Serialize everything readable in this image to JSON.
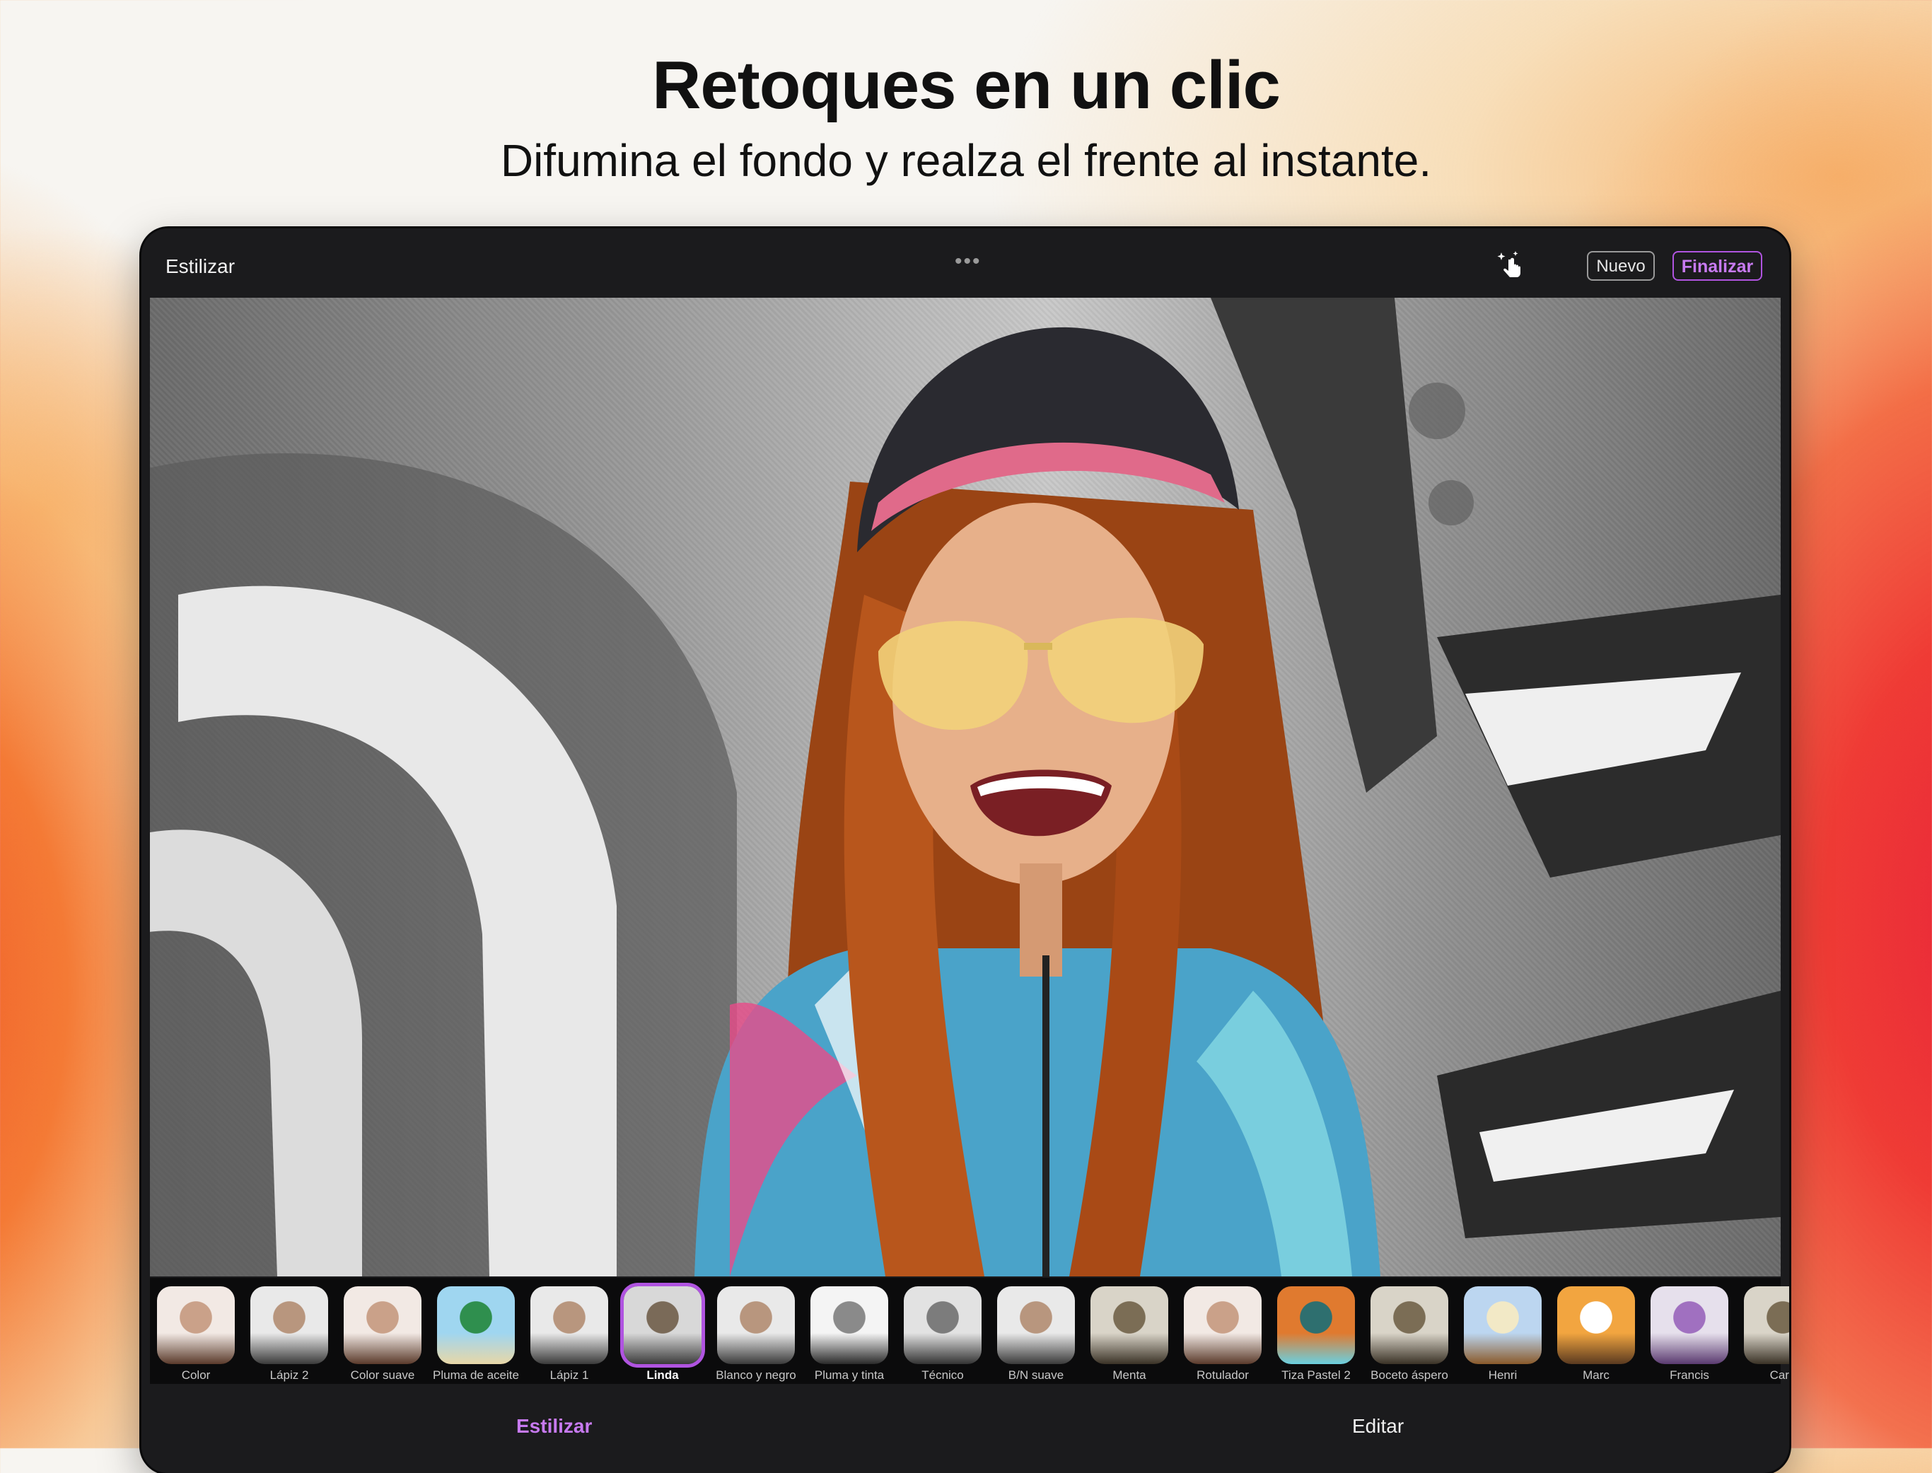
{
  "headline": "Retoques en un clic",
  "subheadline": "Difumina el fondo y realza el frente al instante.",
  "app": {
    "title": "Estilizar",
    "more_icon": "more-dots-icon",
    "magic_icon": "magic-tap-icon",
    "new_button": "Nuevo",
    "done_button": "Finalizar",
    "accent_color": "#b054e0"
  },
  "styles": [
    {
      "label": "Color",
      "icon": "portrait-woman"
    },
    {
      "label": "Lápiz 2",
      "icon": "portrait-man"
    },
    {
      "label": "Color suave",
      "icon": "portrait-woman"
    },
    {
      "label": "Pluma de aceite",
      "icon": "beach-palm"
    },
    {
      "label": "Lápiz 1",
      "icon": "portrait-man"
    },
    {
      "label": "Linda",
      "icon": "giraffe",
      "selected": true
    },
    {
      "label": "Blanco y negro",
      "icon": "portrait-man"
    },
    {
      "label": "Pluma y tinta",
      "icon": "skyscraper"
    },
    {
      "label": "Técnico",
      "icon": "house"
    },
    {
      "label": "B/N suave",
      "icon": "portrait-man"
    },
    {
      "label": "Menta",
      "icon": "building"
    },
    {
      "label": "Rotulador",
      "icon": "portrait-woman"
    },
    {
      "label": "Tiza Pastel 2",
      "icon": "waterfall"
    },
    {
      "label": "Boceto áspero",
      "icon": "building"
    },
    {
      "label": "Henri",
      "icon": "sunflower"
    },
    {
      "label": "Marc",
      "icon": "dog"
    },
    {
      "label": "Francis",
      "icon": "orchid"
    },
    {
      "label": "Carb",
      "icon": "building"
    }
  ],
  "tabs": [
    {
      "label": "Estilizar",
      "active": true
    },
    {
      "label": "Editar",
      "active": false
    }
  ]
}
